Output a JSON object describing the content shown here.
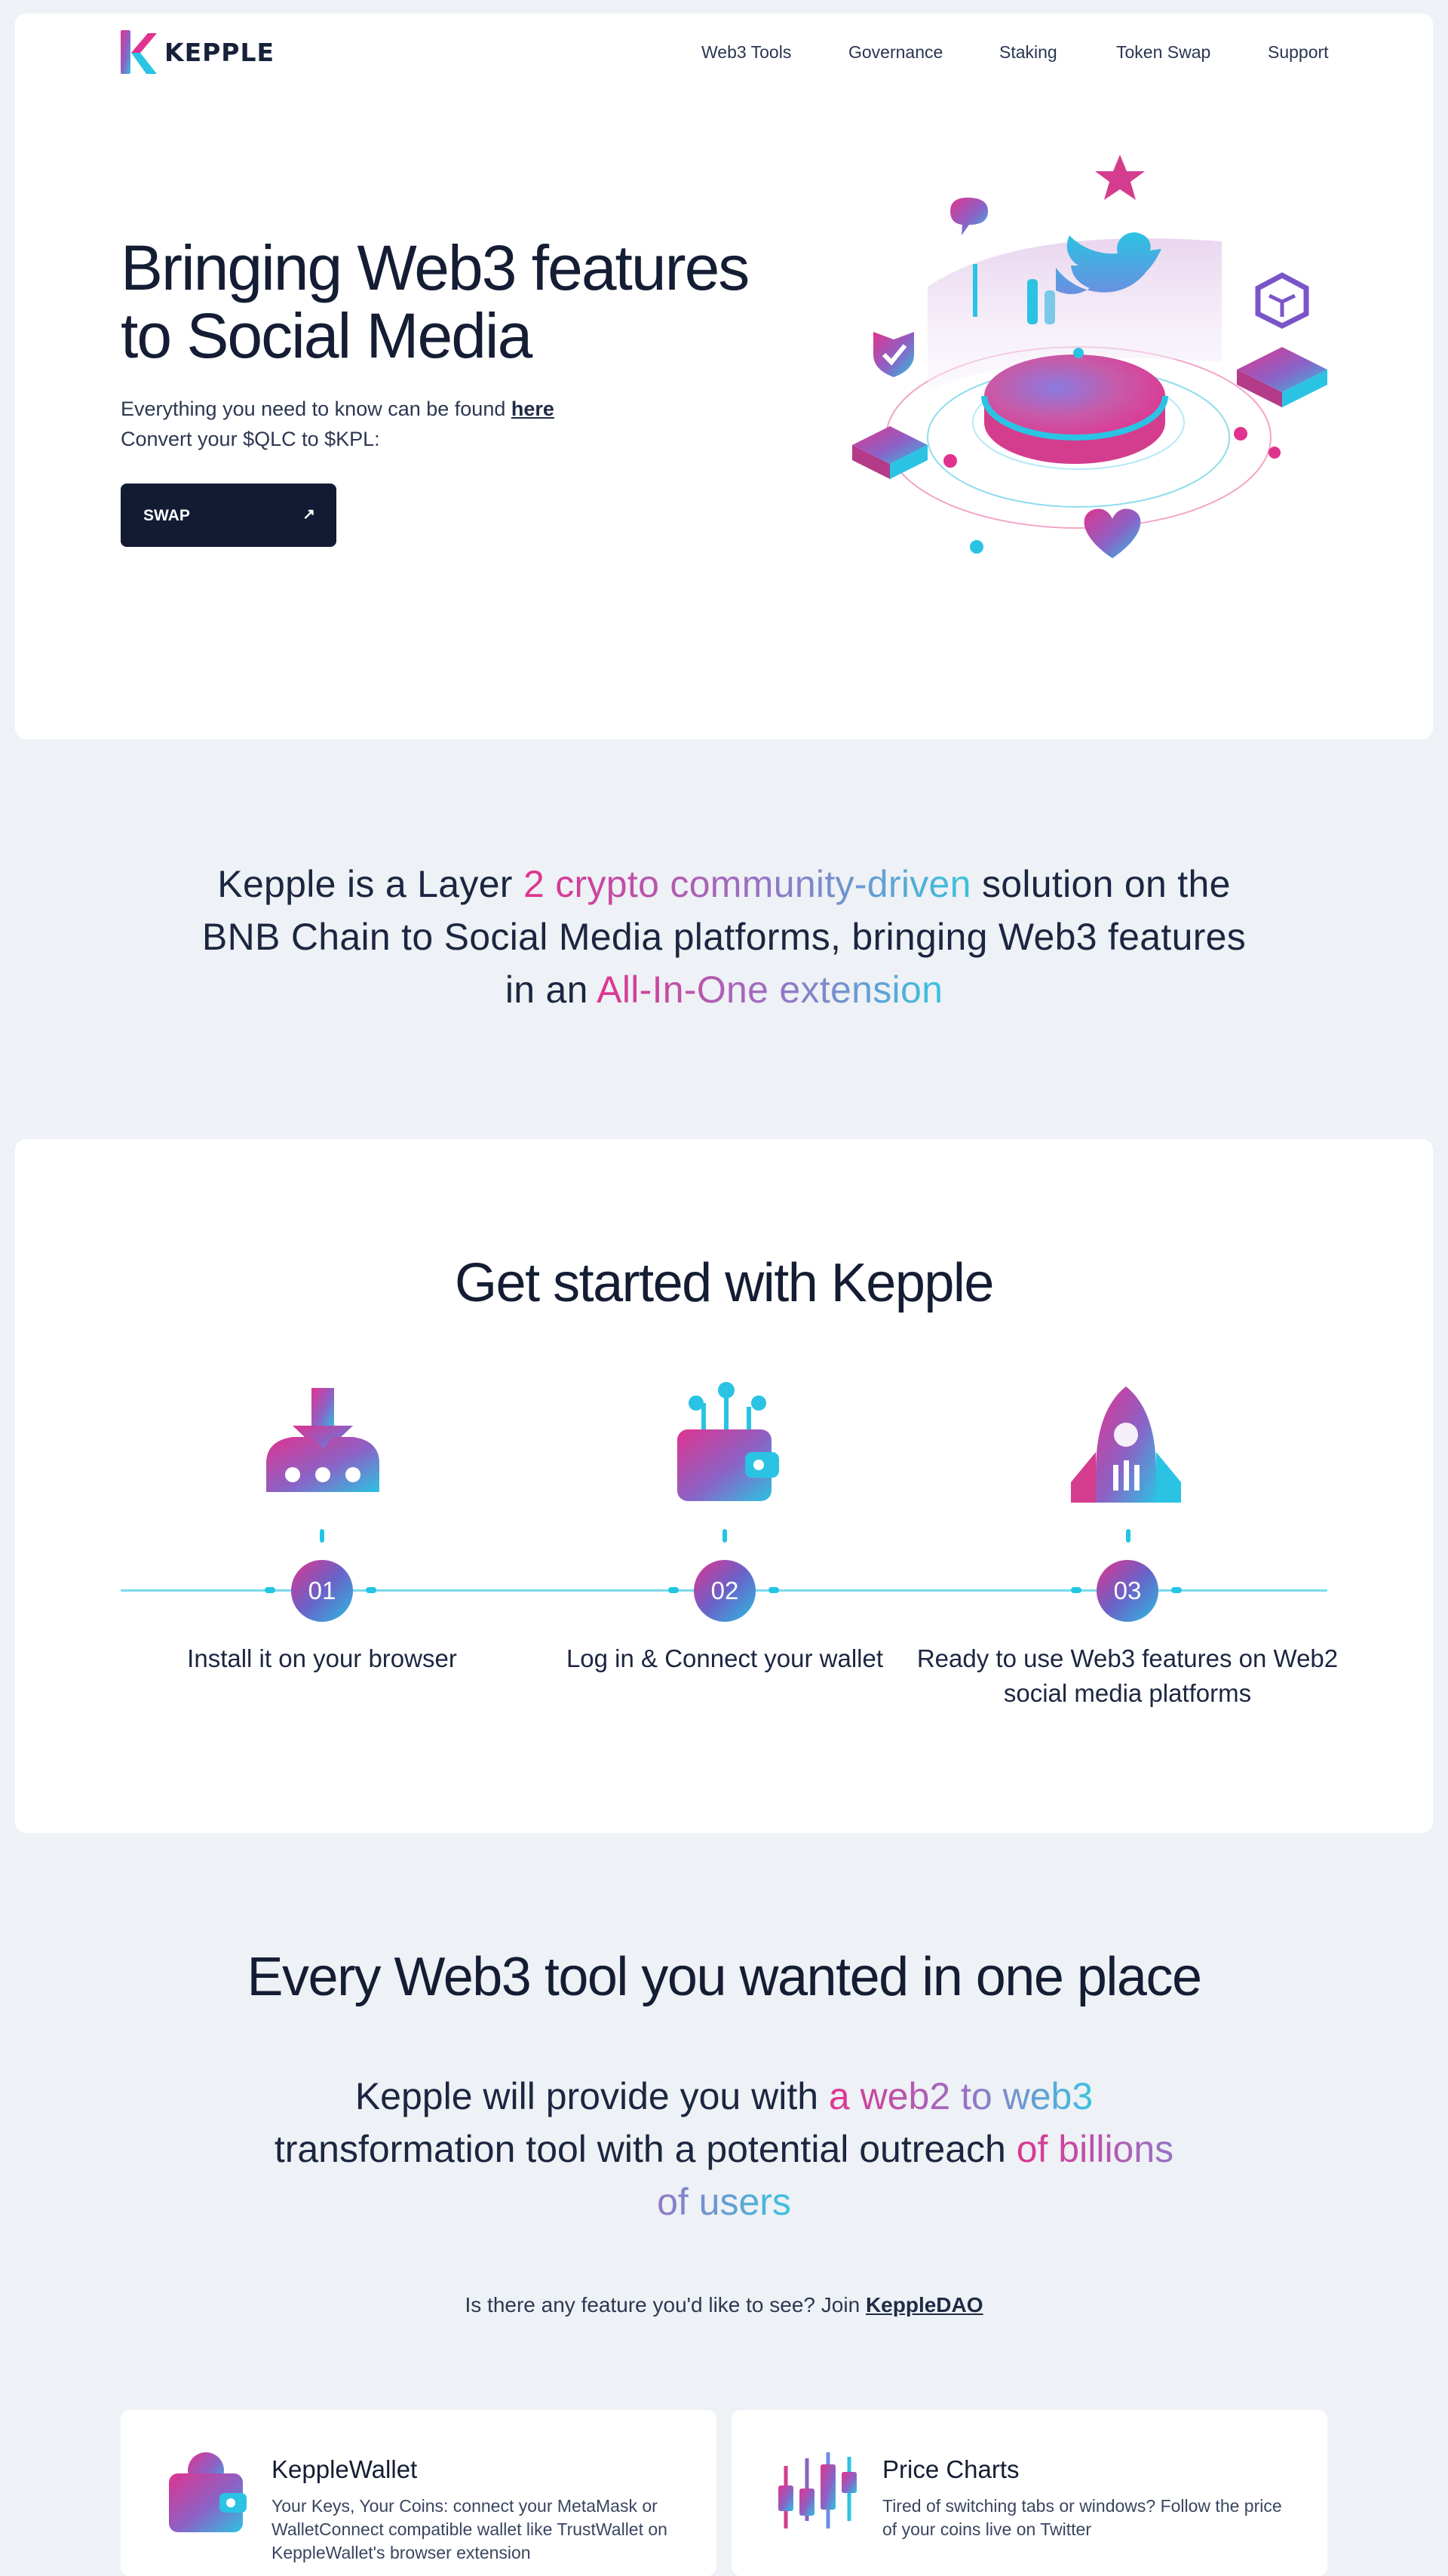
{
  "header": {
    "logo_text": "KEPPLE",
    "nav": [
      "Web3 Tools",
      "Governance",
      "Staking",
      "Token Swap",
      "Support"
    ]
  },
  "hero": {
    "title_line1": "Bringing Web3 features",
    "title_line2": "to Social Media",
    "subtitle_prefix": "Everything you need to know can be found ",
    "subtitle_link": "here",
    "subtitle_line2": "Convert your $QLC to $KPL:",
    "button_label": "SWAP",
    "button_icon": "arrow-up-right-icon"
  },
  "mission": {
    "p1": "Kepple is a Layer ",
    "h1": "2 crypto community-driven",
    "p2": " solution on the BNB Chain to Social Media platforms, bringing Web3 features in an ",
    "h2": "All-In-One extension"
  },
  "steps": {
    "title": "Get started with Kepple",
    "items": [
      {
        "number": "01",
        "label": "Install it on your browser",
        "icon": "download-icon"
      },
      {
        "number": "02",
        "label": "Log in & Connect your wallet",
        "icon": "wallet-icon"
      },
      {
        "number": "03",
        "label": "Ready to use Web3 features on Web2 social media platforms",
        "icon": "rocket-icon"
      }
    ]
  },
  "tools": {
    "title": "Every Web3 tool you wanted in one place",
    "sub_p1": "Kepple will provide you with ",
    "sub_h1": "a web2 to web3",
    "sub_p2": " transformation tool with a potential outreach ",
    "sub_h2": "of billions of users",
    "dao_prefix": "Is there any feature you'd like to see? Join ",
    "dao_link": "KeppleDAO",
    "features": [
      {
        "title": "KeppleWallet",
        "desc": "Your Keys, Your Coins: connect your MetaMask or WalletConnect compatible wallet like TrustWallet on KeppleWallet's browser extension",
        "icon": "wallet-icon"
      },
      {
        "title": "Price Charts",
        "desc": "Tired of switching tabs or windows? Follow the price of your coins live on Twitter",
        "icon": "candlestick-chart-icon"
      }
    ]
  },
  "colors": {
    "brand_pink": "#e0338f",
    "brand_purple": "#8f68c4",
    "brand_cyan": "#2bc3e3",
    "navy": "#121b33",
    "page_bg": "#eef1f5"
  }
}
